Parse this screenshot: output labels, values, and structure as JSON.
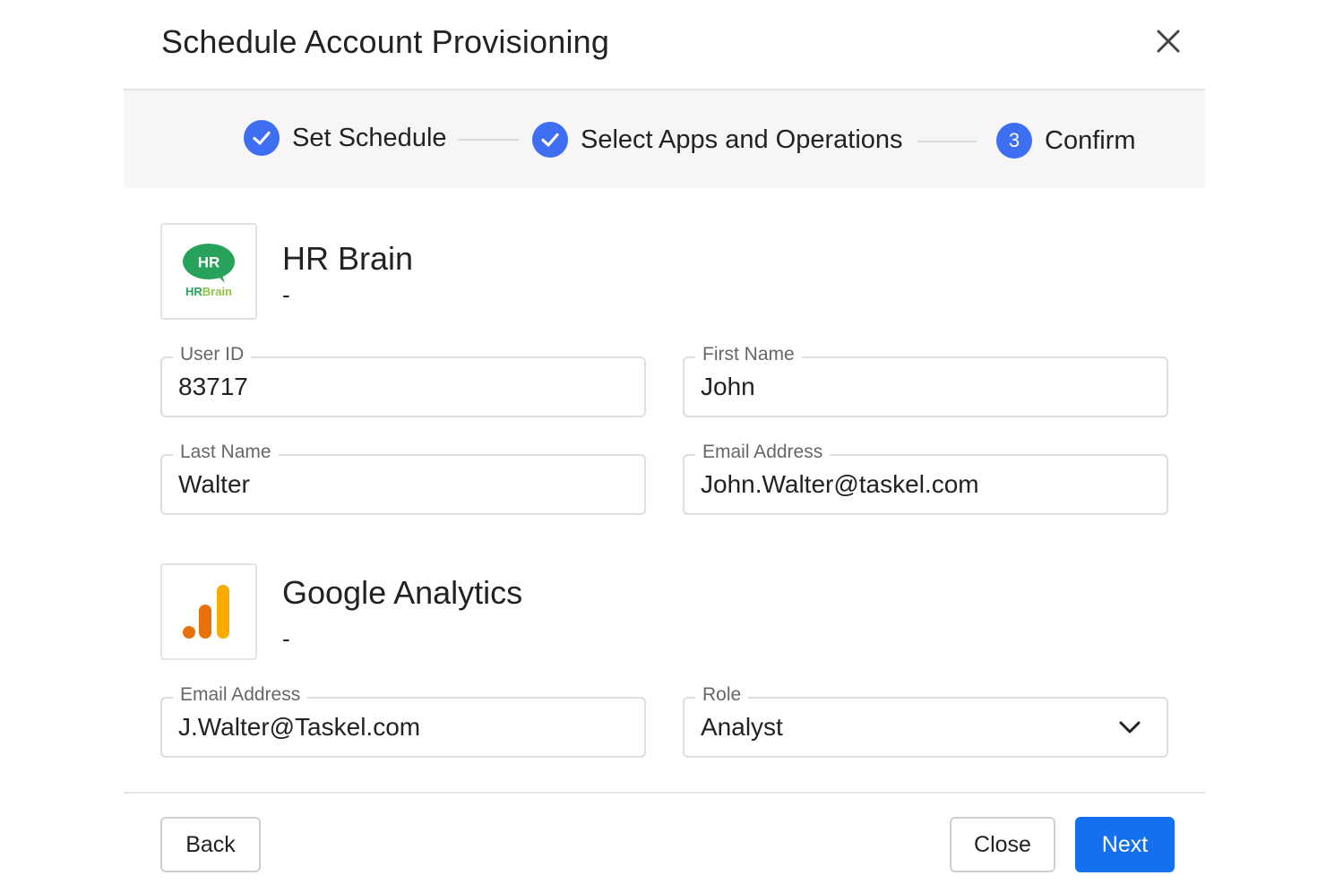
{
  "dialog": {
    "title": "Schedule Account Provisioning",
    "close_icon": "close-icon"
  },
  "stepper": {
    "steps": [
      {
        "label": "Set Schedule",
        "state": "completed",
        "icon": "check-icon"
      },
      {
        "label": "Select Apps and Operations",
        "state": "completed",
        "icon": "check-icon"
      },
      {
        "label": "Confirm",
        "state": "current",
        "number": "3"
      }
    ],
    "accent_color": "#3e6ff2"
  },
  "apps": [
    {
      "name": "HR Brain",
      "subtitle": "-",
      "logo": {
        "badge_text": "HR",
        "wordmark_left": "HR",
        "wordmark_right": "Brain",
        "color": "#27a25a"
      },
      "fields": [
        {
          "label": "User ID",
          "value": "83717"
        },
        {
          "label": "First Name",
          "value": "John"
        },
        {
          "label": "Last Name",
          "value": "Walter"
        },
        {
          "label": "Email Address",
          "value": "John.Walter@taskel.com"
        }
      ]
    },
    {
      "name": "Google Analytics",
      "subtitle": "-",
      "logo": {
        "icon": "google-analytics-icon",
        "colors": [
          "#e8710a",
          "#f9ab00"
        ]
      },
      "fields": [
        {
          "label": "Email Address",
          "value": "J.Walter@Taskel.com"
        },
        {
          "label": "Role",
          "value": "Analyst",
          "type": "select"
        }
      ]
    }
  ],
  "footer": {
    "back_label": "Back",
    "close_label": "Close",
    "next_label": "Next",
    "primary_color": "#1470ee"
  }
}
